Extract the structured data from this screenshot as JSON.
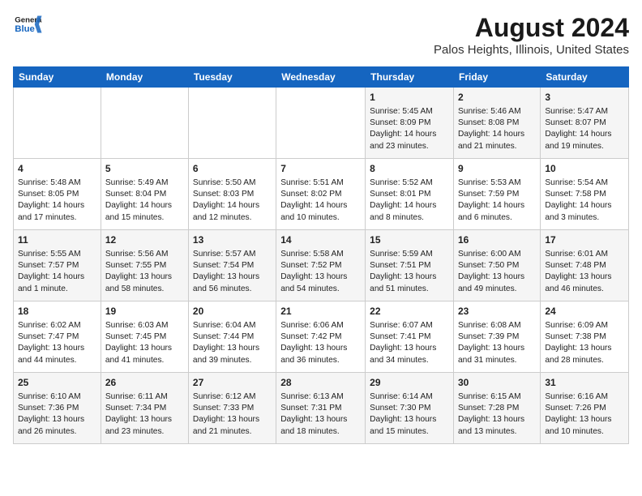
{
  "header": {
    "logo_line1": "General",
    "logo_line2": "Blue",
    "title": "August 2024",
    "subtitle": "Palos Heights, Illinois, United States"
  },
  "days_of_week": [
    "Sunday",
    "Monday",
    "Tuesday",
    "Wednesday",
    "Thursday",
    "Friday",
    "Saturday"
  ],
  "weeks": [
    [
      {
        "day": "",
        "content": ""
      },
      {
        "day": "",
        "content": ""
      },
      {
        "day": "",
        "content": ""
      },
      {
        "day": "",
        "content": ""
      },
      {
        "day": "1",
        "content": "Sunrise: 5:45 AM\nSunset: 8:09 PM\nDaylight: 14 hours and 23 minutes."
      },
      {
        "day": "2",
        "content": "Sunrise: 5:46 AM\nSunset: 8:08 PM\nDaylight: 14 hours and 21 minutes."
      },
      {
        "day": "3",
        "content": "Sunrise: 5:47 AM\nSunset: 8:07 PM\nDaylight: 14 hours and 19 minutes."
      }
    ],
    [
      {
        "day": "4",
        "content": "Sunrise: 5:48 AM\nSunset: 8:05 PM\nDaylight: 14 hours and 17 minutes."
      },
      {
        "day": "5",
        "content": "Sunrise: 5:49 AM\nSunset: 8:04 PM\nDaylight: 14 hours and 15 minutes."
      },
      {
        "day": "6",
        "content": "Sunrise: 5:50 AM\nSunset: 8:03 PM\nDaylight: 14 hours and 12 minutes."
      },
      {
        "day": "7",
        "content": "Sunrise: 5:51 AM\nSunset: 8:02 PM\nDaylight: 14 hours and 10 minutes."
      },
      {
        "day": "8",
        "content": "Sunrise: 5:52 AM\nSunset: 8:01 PM\nDaylight: 14 hours and 8 minutes."
      },
      {
        "day": "9",
        "content": "Sunrise: 5:53 AM\nSunset: 7:59 PM\nDaylight: 14 hours and 6 minutes."
      },
      {
        "day": "10",
        "content": "Sunrise: 5:54 AM\nSunset: 7:58 PM\nDaylight: 14 hours and 3 minutes."
      }
    ],
    [
      {
        "day": "11",
        "content": "Sunrise: 5:55 AM\nSunset: 7:57 PM\nDaylight: 14 hours and 1 minute."
      },
      {
        "day": "12",
        "content": "Sunrise: 5:56 AM\nSunset: 7:55 PM\nDaylight: 13 hours and 58 minutes."
      },
      {
        "day": "13",
        "content": "Sunrise: 5:57 AM\nSunset: 7:54 PM\nDaylight: 13 hours and 56 minutes."
      },
      {
        "day": "14",
        "content": "Sunrise: 5:58 AM\nSunset: 7:52 PM\nDaylight: 13 hours and 54 minutes."
      },
      {
        "day": "15",
        "content": "Sunrise: 5:59 AM\nSunset: 7:51 PM\nDaylight: 13 hours and 51 minutes."
      },
      {
        "day": "16",
        "content": "Sunrise: 6:00 AM\nSunset: 7:50 PM\nDaylight: 13 hours and 49 minutes."
      },
      {
        "day": "17",
        "content": "Sunrise: 6:01 AM\nSunset: 7:48 PM\nDaylight: 13 hours and 46 minutes."
      }
    ],
    [
      {
        "day": "18",
        "content": "Sunrise: 6:02 AM\nSunset: 7:47 PM\nDaylight: 13 hours and 44 minutes."
      },
      {
        "day": "19",
        "content": "Sunrise: 6:03 AM\nSunset: 7:45 PM\nDaylight: 13 hours and 41 minutes."
      },
      {
        "day": "20",
        "content": "Sunrise: 6:04 AM\nSunset: 7:44 PM\nDaylight: 13 hours and 39 minutes."
      },
      {
        "day": "21",
        "content": "Sunrise: 6:06 AM\nSunset: 7:42 PM\nDaylight: 13 hours and 36 minutes."
      },
      {
        "day": "22",
        "content": "Sunrise: 6:07 AM\nSunset: 7:41 PM\nDaylight: 13 hours and 34 minutes."
      },
      {
        "day": "23",
        "content": "Sunrise: 6:08 AM\nSunset: 7:39 PM\nDaylight: 13 hours and 31 minutes."
      },
      {
        "day": "24",
        "content": "Sunrise: 6:09 AM\nSunset: 7:38 PM\nDaylight: 13 hours and 28 minutes."
      }
    ],
    [
      {
        "day": "25",
        "content": "Sunrise: 6:10 AM\nSunset: 7:36 PM\nDaylight: 13 hours and 26 minutes."
      },
      {
        "day": "26",
        "content": "Sunrise: 6:11 AM\nSunset: 7:34 PM\nDaylight: 13 hours and 23 minutes."
      },
      {
        "day": "27",
        "content": "Sunrise: 6:12 AM\nSunset: 7:33 PM\nDaylight: 13 hours and 21 minutes."
      },
      {
        "day": "28",
        "content": "Sunrise: 6:13 AM\nSunset: 7:31 PM\nDaylight: 13 hours and 18 minutes."
      },
      {
        "day": "29",
        "content": "Sunrise: 6:14 AM\nSunset: 7:30 PM\nDaylight: 13 hours and 15 minutes."
      },
      {
        "day": "30",
        "content": "Sunrise: 6:15 AM\nSunset: 7:28 PM\nDaylight: 13 hours and 13 minutes."
      },
      {
        "day": "31",
        "content": "Sunrise: 6:16 AM\nSunset: 7:26 PM\nDaylight: 13 hours and 10 minutes."
      }
    ]
  ]
}
